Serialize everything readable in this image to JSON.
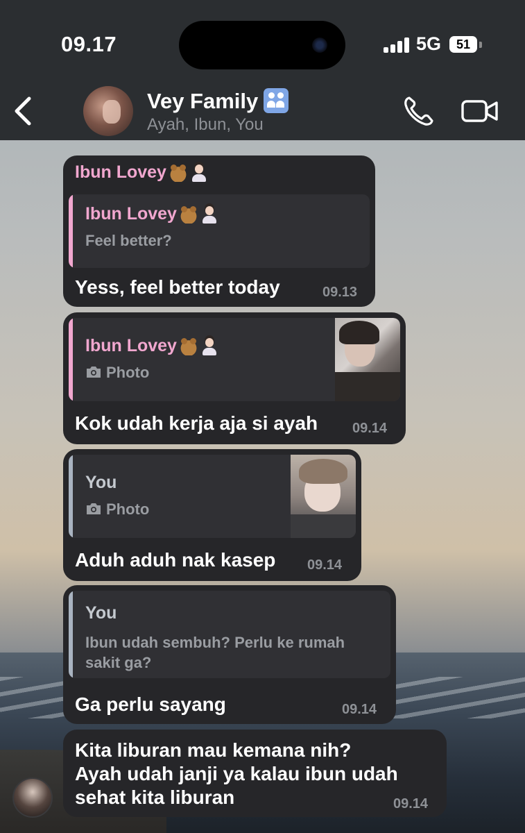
{
  "status_bar": {
    "time": "09.17",
    "network": "5G",
    "battery": "51"
  },
  "chat_header": {
    "title": "Vey Family",
    "title_icon": "family-emoji",
    "members": "Ayah, Ibun, You",
    "icons": [
      "chevron-left-icon",
      "phone-icon",
      "video-icon"
    ]
  },
  "messages": [
    {
      "sender": "Ibun Lovey",
      "sender_emojis": [
        "teddy-bear",
        "woman-technologist"
      ],
      "reply_to": {
        "name": "Ibun Lovey",
        "emojis": [
          "teddy-bear",
          "woman-technologist"
        ],
        "text": "Feel better?"
      },
      "text": "Yess, feel better today",
      "time": "09.13"
    },
    {
      "reply_to": {
        "name": "Ibun Lovey",
        "emojis": [
          "teddy-bear",
          "woman-technologist"
        ],
        "text": "Photo",
        "has_thumbnail": true
      },
      "text": "Kok udah kerja aja si ayah",
      "time": "09.14"
    },
    {
      "reply_to": {
        "name": "You",
        "text": "Photo",
        "has_thumbnail": true
      },
      "text": "Aduh aduh nak kasep",
      "time": "09.14"
    },
    {
      "reply_to": {
        "name": "You",
        "text_lines": [
          "Ibun udah sembuh? Perlu ke rumah",
          "sakit ga?"
        ]
      },
      "text": "Ga perlu sayang",
      "time": "09.14"
    },
    {
      "text_lines": [
        "Kita liburan mau kemana nih?",
        "Ayah udah janji ya kalau ibun udah",
        "sehat kita liburan"
      ],
      "time": "09.14"
    }
  ],
  "colors": {
    "header_bg": "#2b2e31",
    "bubble_bg": "#262629",
    "quote_bg": "#303034",
    "sender_pink": "#f1a7cf",
    "quote_bar_grey": "#a9b3c0",
    "timestamp": "#8e9196"
  }
}
